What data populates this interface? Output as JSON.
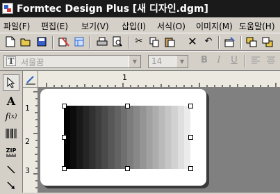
{
  "window": {
    "title": "Formtec Design Plus [새 디자인.dgm]"
  },
  "menu": {
    "items": [
      {
        "id": "file",
        "label": "파일(F)"
      },
      {
        "id": "edit",
        "label": "편집(E)"
      },
      {
        "id": "view",
        "label": "보기(V)"
      },
      {
        "id": "insert",
        "label": "삽입(I)"
      },
      {
        "id": "format",
        "label": "서식(O)"
      },
      {
        "id": "image",
        "label": "이미지(M)"
      },
      {
        "id": "help",
        "label": "도움말(H)"
      }
    ]
  },
  "format_toolbar": {
    "font_name": "서울꿈",
    "font_size": "14",
    "bold_label": "B",
    "italic_label": "I",
    "underline_label": "U"
  },
  "tools": {
    "text_label": "A",
    "barcode_label": "ZIP"
  },
  "ruler": {
    "h_label": "1",
    "v_labels": [
      "1",
      "2",
      "3"
    ]
  },
  "canvas": {
    "gradient": {
      "start_color": "#000000",
      "end_color": "#ffffff",
      "bands": 20
    }
  }
}
